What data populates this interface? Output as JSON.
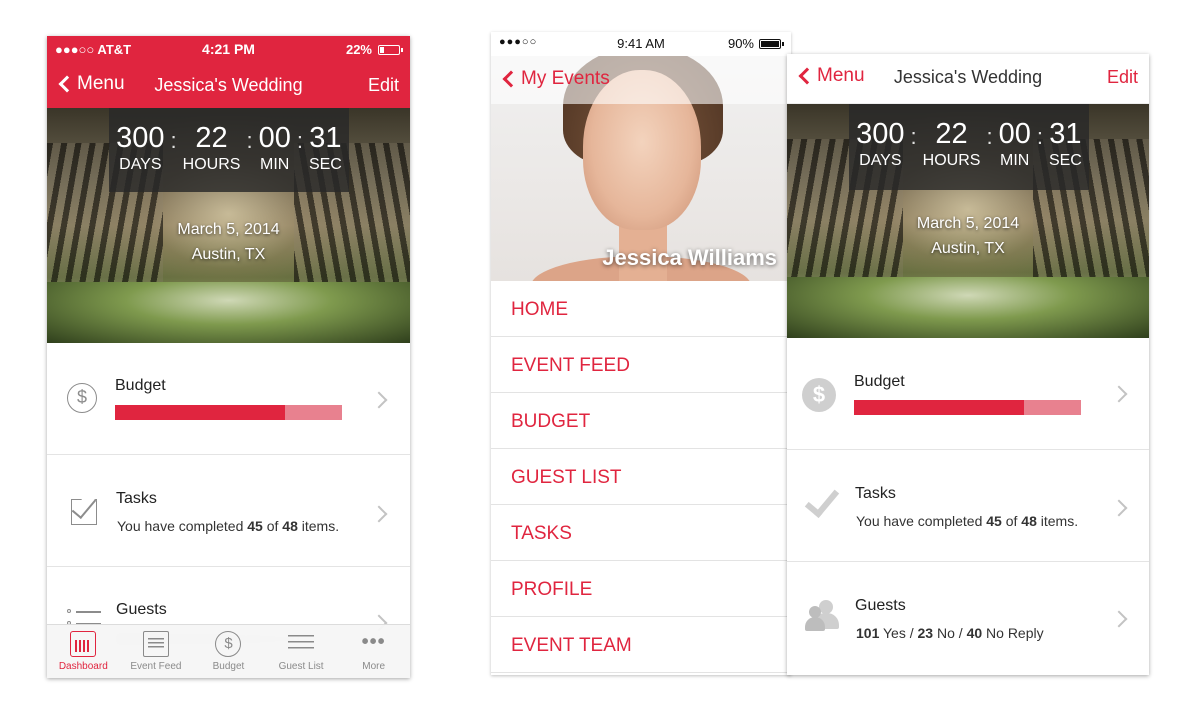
{
  "colors": {
    "accent": "#e0253f",
    "accent_light": "#e8818f",
    "icon_gray": "#cfcfcf"
  },
  "phone1": {
    "status": {
      "carrier": "●●●○○ AT&T",
      "time": "4:21 PM",
      "battery": "22%",
      "battery_level": 0.22
    },
    "nav": {
      "back_label": "Menu",
      "title": "Jessica's Wedding",
      "edit_label": "Edit"
    },
    "countdown": {
      "days": "300",
      "hours": "22",
      "min": "00",
      "sec": "31",
      "days_label": "DAYS",
      "hours_label": "HOURS",
      "min_label": "MIN",
      "sec_label": "SEC"
    },
    "event": {
      "date": "March 5, 2014",
      "location": "Austin, TX"
    },
    "budget": {
      "title": "Budget",
      "icon": "dollar-icon",
      "spent_fraction": 0.75
    },
    "tasks": {
      "title": "Tasks",
      "icon": "checkbox-icon",
      "prefix": "You have completed ",
      "done": "45",
      "mid": " of ",
      "total": "48",
      "suffix": " items."
    },
    "guests": {
      "title": "Guests",
      "icon": "list-icon"
    },
    "tabs": [
      {
        "label": "Dashboard",
        "icon": "dashboard-icon",
        "active": true
      },
      {
        "label": "Event Feed",
        "icon": "feed-icon",
        "active": false
      },
      {
        "label": "Budget",
        "icon": "dollar-icon",
        "active": false
      },
      {
        "label": "Guest List",
        "icon": "list-icon",
        "active": false
      },
      {
        "label": "More",
        "icon": "more-icon",
        "active": false
      }
    ]
  },
  "phone2": {
    "status": {
      "signal": "●●●○○",
      "time": "9:41 AM",
      "battery": "90%",
      "battery_level": 0.9
    },
    "nav": {
      "back_label": "My Events"
    },
    "profile_name": "Jessica Williams",
    "menu": [
      {
        "label": "HOME"
      },
      {
        "label": "EVENT FEED"
      },
      {
        "label": "BUDGET"
      },
      {
        "label": "GUEST LIST"
      },
      {
        "label": "TASKS"
      },
      {
        "label": "PROFILE"
      },
      {
        "label": "EVENT TEAM"
      }
    ]
  },
  "phone3": {
    "nav": {
      "back_label": "Menu",
      "title": "Jessica's Wedding",
      "edit_label": "Edit"
    },
    "countdown": {
      "days": "300",
      "hours": "22",
      "min": "00",
      "sec": "31",
      "days_label": "DAYS",
      "hours_label": "HOURS",
      "min_label": "MIN",
      "sec_label": "SEC"
    },
    "event": {
      "date": "March 5, 2014",
      "location": "Austin, TX"
    },
    "budget": {
      "title": "Budget",
      "icon": "dollar-icon",
      "spent_fraction": 0.75
    },
    "tasks": {
      "title": "Tasks",
      "icon": "checkmark-icon",
      "prefix": "You have completed ",
      "done": "45",
      "mid": " of ",
      "total": "48",
      "suffix": " items."
    },
    "guests": {
      "title": "Guests",
      "icon": "people-icon",
      "yes_count": "101",
      "yes_label": " Yes / ",
      "no_count": "23",
      "no_label": " No / ",
      "noreply_count": "40",
      "noreply_label": " No Reply"
    }
  }
}
